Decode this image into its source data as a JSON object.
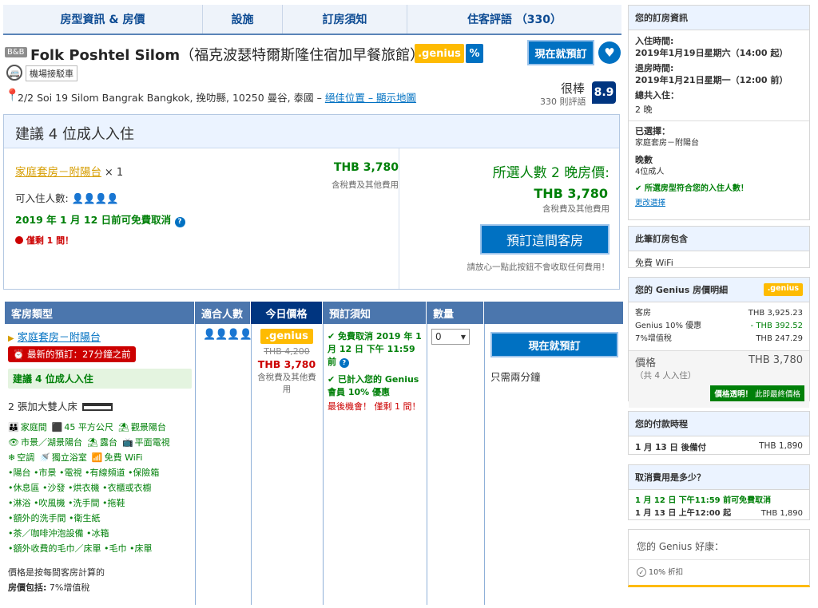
{
  "tabs": [
    "房型資訊 & 房價",
    "設施",
    "訂房須知",
    "住客評語 （330）"
  ],
  "header": {
    "bb_badge": "B&B",
    "hotel_name_en": "Folk Poshtel Silom",
    "hotel_name_zh": "（福克波瑟特爾斯隆住宿加早餐旅館）",
    "genius_label": ".genius",
    "genius_pct": "%",
    "book_now": "現在就預訂",
    "shuttle": "機場接駁車",
    "address": "2/2 Soi 19 Silom Bangrak Bangkok, 挽叻縣, 10250 曼谷, 泰國 –",
    "map_link": "絕佳位置 – 顯示地圖",
    "review_word": "很棒",
    "review_count": "330 則評語",
    "score": "8.9"
  },
  "recommend": {
    "title": "建議 4 位成人入住",
    "room_name": "家庭套房－附陽台",
    "room_qty": "× 1",
    "price": "THB 3,780",
    "price_note": "含稅費及其他費用",
    "capacity_label": "可入住人數:",
    "free_cancel": "2019 年 1 月 12 日前可免費取消",
    "only_left": "僅剩 1 間！",
    "total_label": "所選人數 2 晚房價:",
    "total_price": "THB 3,780",
    "total_note": "含稅費及其他費用",
    "reserve_btn": "預訂這間客房",
    "reserve_note": "請放心一點此按鈕不會收取任何費用！"
  },
  "table": {
    "headers": [
      "客房類型",
      "適合人數",
      "今日價格",
      "預訂須知",
      "數量"
    ],
    "room_name": "家庭套房－附陽台",
    "last_booked": "最新的預訂：27分鐘之前",
    "recommend_tag": "建議 4 位成人入住",
    "bed": "2 張加大雙人床",
    "facilities_icons": [
      {
        "icon": "family-room-icon",
        "label": "家庭間"
      },
      {
        "icon": "area-icon",
        "label": "45 平方公尺"
      },
      {
        "icon": "balcony-icon",
        "label": "觀景陽台"
      },
      {
        "icon": "view-icon",
        "label": "市景／湖景陽台"
      },
      {
        "icon": "terrace-icon",
        "label": "露台"
      },
      {
        "icon": "tv-icon",
        "label": "平面電視"
      },
      {
        "icon": "aircon-icon",
        "label": "空調"
      },
      {
        "icon": "bathroom-icon",
        "label": "獨立浴室"
      },
      {
        "icon": "wifi-icon",
        "label": "免費 WiFi"
      }
    ],
    "facility_lines": [
      "•陽台 •市景 •電視 •有線頻道 •保險箱",
      "•休息區 •沙發 •烘衣機 •衣櫃或衣櫥",
      "•淋浴 •吹風機 •洗手間 •拖鞋",
      "•額外的洗手間 •衛生紙",
      "•茶／咖啡沖泡設備 •冰箱",
      "•額外收費的毛巾／床單 •毛巾 •床單"
    ],
    "price_basis": "價格是按每間客房計算的",
    "price_includes_label": "房價包括:",
    "price_includes": "7%增值稅",
    "genius_label": ".genius",
    "old_price": "THB 4,200",
    "new_price": "THB 3,780",
    "tax_note": "含稅費及其他費用",
    "policy_cancel": "免費取消 2019 年 1 月 12 日 下午 11:59 前",
    "policy_genius": "已計入您的 Genius 會員 10% 優惠",
    "policy_last": "最後機會！ 僅剩 1 間！",
    "qty_value": "0",
    "book_now": "現在就預訂",
    "two_min": "只需兩分鐘"
  },
  "sidebar": {
    "booking": {
      "title": "您的訂房資訊",
      "checkin_label": "入住時間:",
      "checkin": "2019年1月19日星期六（14:00 起）",
      "checkout_label": "退房時間:",
      "checkout": "2019年1月21日星期一（12:00 前）",
      "total_label": "總共入住：",
      "total": "2 晚",
      "selected_label": "已選擇：",
      "selected": "家庭套房－附陽台",
      "nights_label": "晚數",
      "nights": "4位成人",
      "fit_note": "所選房型符合您的入住人數！",
      "change": "更改選擇"
    },
    "includes": {
      "title": "此筆訂房包含",
      "item": "免費 WiFi"
    },
    "genius_breakdown": {
      "title": "您的 Genius 房價明細",
      "genius_label": ".genius",
      "rows": [
        {
          "label": "客房",
          "value": "THB 3,925.23"
        },
        {
          "label": "Genius 10% 優惠",
          "value": "- THB 392.52"
        },
        {
          "label": "7%增值稅",
          "value": "THB 247.29"
        }
      ],
      "price_label": "價格",
      "price": "THB 3,780",
      "guests": "（共 4 人入住）",
      "transparent_bold": "價格透明！",
      "transparent": "此即最終價格"
    },
    "payment": {
      "title": "您的付款時程",
      "date": "1 月 13 日 後備付",
      "amount": "THB 1,890"
    },
    "cancel": {
      "title": "取消費用是多少？",
      "free": "1 月 12 日 下午11:59 前可免費取消",
      "from": "1 月 13 日 上午12:00 起",
      "amount": "THB 1,890"
    },
    "genius_perks": {
      "title": "您的 Genius 好康：",
      "item": "10% 折扣"
    }
  },
  "colors": {
    "brand_blue": "#0071c2",
    "dark_blue": "#003580",
    "genius_yellow": "#febb02",
    "green": "#008009",
    "red": "#cc0000"
  }
}
